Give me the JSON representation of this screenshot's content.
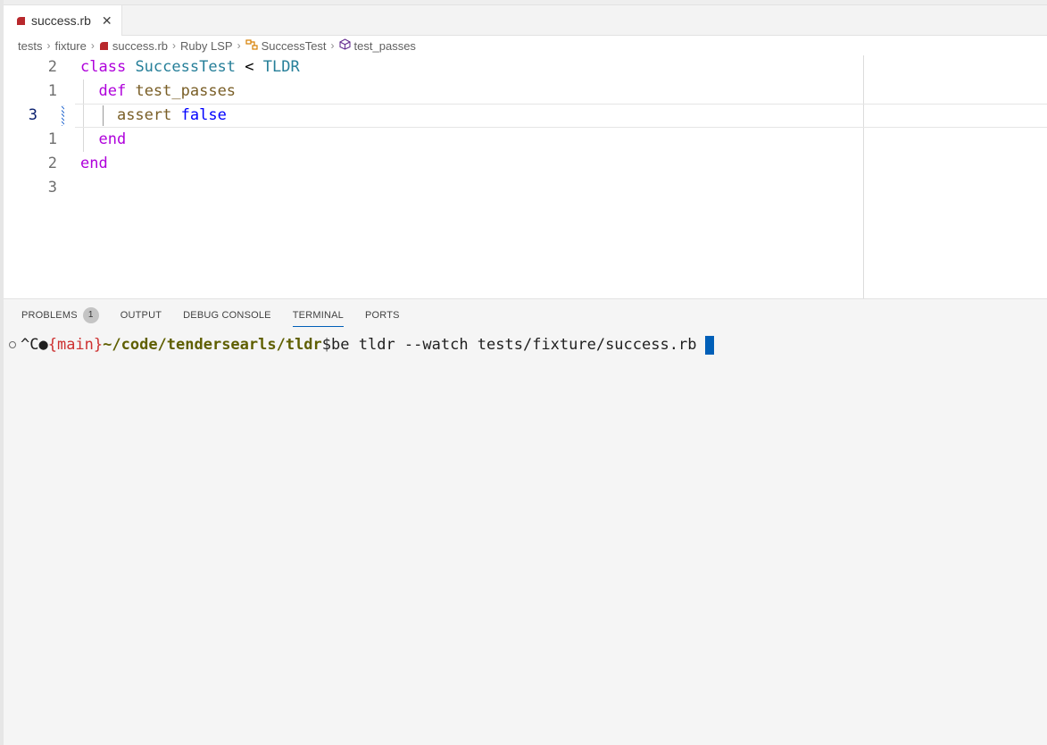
{
  "tab": {
    "filename": "success.rb",
    "close_glyph": "✕"
  },
  "breadcrumbs": {
    "items": [
      "tests",
      "fixture",
      "success.rb",
      "Ruby LSP",
      "SuccessTest",
      "test_passes"
    ],
    "separator": "›"
  },
  "editor": {
    "lines": [
      {
        "number": "2",
        "active": false
      },
      {
        "number": "1",
        "active": false
      },
      {
        "number": "3",
        "active": true
      },
      {
        "number": "1",
        "active": false
      },
      {
        "number": "2",
        "active": false
      },
      {
        "number": "3",
        "active": false
      }
    ],
    "tokens": {
      "l1_class": "class",
      "l1_name": "SuccessTest",
      "l1_lt": "<",
      "l1_parent": "TLDR",
      "l2_def": "def",
      "l2_method": "test_passes",
      "l3_assert": "assert",
      "l3_false": "false",
      "l4_end": "end",
      "l5_end": "end"
    }
  },
  "panel": {
    "tabs": [
      {
        "label": "PROBLEMS",
        "badge": "1"
      },
      {
        "label": "OUTPUT"
      },
      {
        "label": "DEBUG CONSOLE"
      },
      {
        "label": "TERMINAL",
        "active": true
      },
      {
        "label": "PORTS"
      }
    ]
  },
  "terminal": {
    "prefix": "^C●",
    "branch": "{main}",
    "path": "~/code/tendersearls/tldr",
    "prompt": "$",
    "command": "be tldr --watch tests/fixture/success.rb"
  },
  "colors": {
    "keyword": "#af00db",
    "class_name": "#267f99",
    "function": "#795e26",
    "literal": "#0000ff",
    "accent": "#005fb8",
    "ruby_red": "#b8282c"
  }
}
